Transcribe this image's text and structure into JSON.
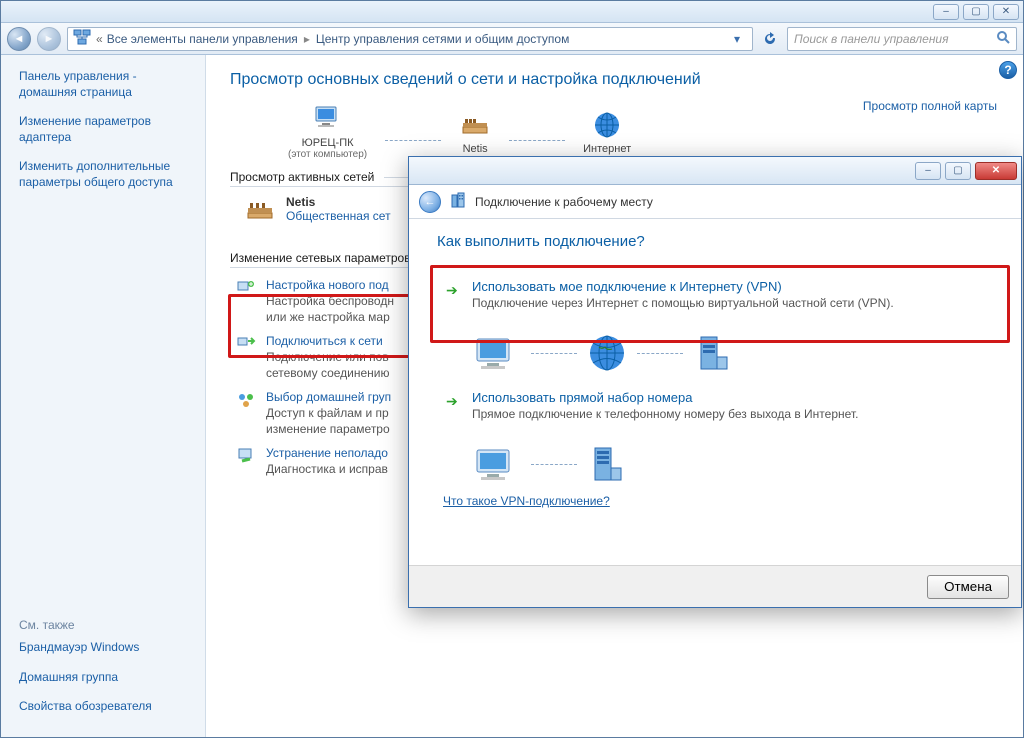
{
  "titlebar": {
    "min": "–",
    "max": "▢",
    "close": "✕"
  },
  "addr": {
    "bc1": "Все элементы панели управления",
    "bc2": "Центр управления сетями и общим доступом",
    "search_placeholder": "Поиск в панели управления"
  },
  "sidebar": {
    "home": "Панель управления - домашняя страница",
    "l1": "Изменение параметров адаптера",
    "l2": "Изменить дополнительные параметры общего доступа",
    "see_also": "См. также",
    "f1": "Брандмауэр Windows",
    "f2": "Домашняя группа",
    "f3": "Свойства обозревателя"
  },
  "main": {
    "h1": "Просмотр основных сведений о сети и настройка подключений",
    "seeMap": "Просмотр полной карты",
    "pc": "ЮРЕЦ-ПК",
    "pc_sub": "(этот компьютер)",
    "router": "Netis",
    "internet": "Интернет",
    "activeHead": "Просмотр активных сетей",
    "netName": "Netis",
    "netType": "Общественная сет",
    "paramsHead": "Изменение сетевых параметров",
    "p1t": "Настройка нового под",
    "p1d1": "Настройка беспроводн",
    "p1d2": "или же настройка мар",
    "p2t": "Подключиться к сети",
    "p2d1": "Подключение или пов",
    "p2d2": "сетевому соединению",
    "p3t": "Выбор домашней груп",
    "p3d1": "Доступ к файлам и пр",
    "p3d2": "изменение параметро",
    "p4t": "Устранение неполадо",
    "p4d1": "Диагностика и исправ"
  },
  "dialog": {
    "title": "Подключение к рабочему месту",
    "h2": "Как выполнить подключение?",
    "opt1t": "Использовать мое подключение к Интернету (VPN)",
    "opt1d": "Подключение через Интернет с помощью виртуальной частной сети (VPN).",
    "opt2t": "Использовать прямой набор номера",
    "opt2d": "Прямое подключение к телефонному номеру без выхода в Интернет.",
    "vpnLink": "Что такое VPN-подключение?",
    "cancel": "Отмена",
    "min": "–",
    "max": "▢",
    "close": "✕"
  }
}
